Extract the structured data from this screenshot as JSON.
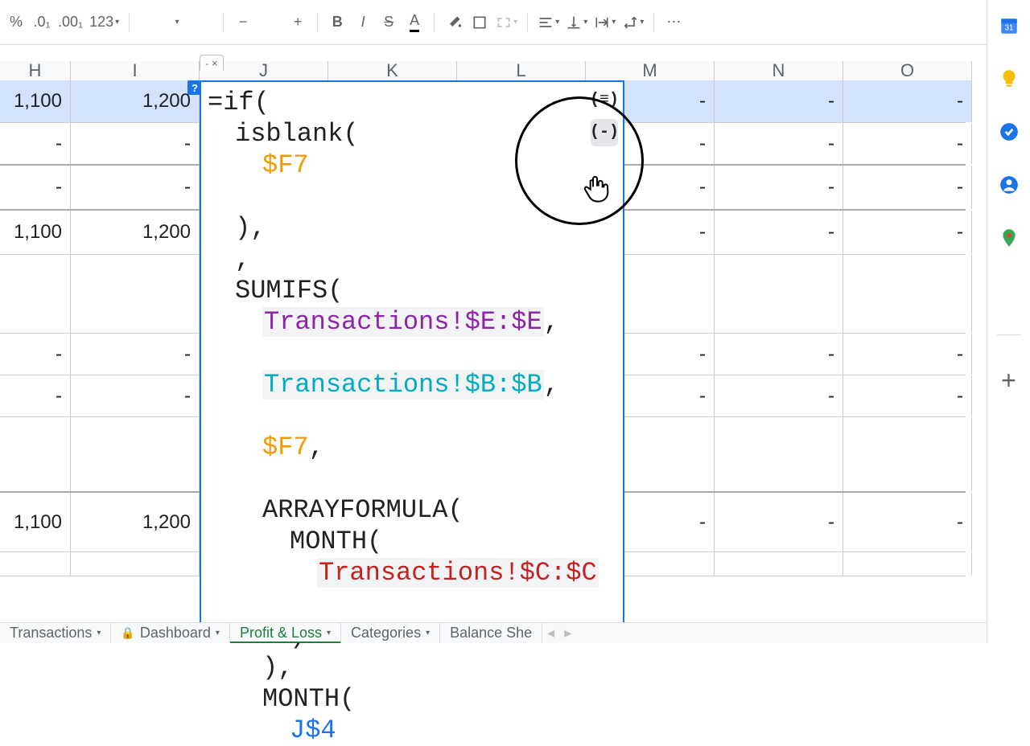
{
  "toolbar": {
    "percent_label": "%",
    "decdec_label": ".0₁",
    "incdec_label": ".00₁",
    "numfmt_label": "123",
    "bold_label": "B",
    "italic_label": "I"
  },
  "columns": [
    "H",
    "I",
    "J",
    "K",
    "L",
    "M",
    "N",
    "O"
  ],
  "rows": [
    {
      "sel": true,
      "css": "row-h53",
      "cells": [
        "1,100",
        "1,200",
        "",
        "",
        "",
        "-",
        "-",
        "-"
      ]
    },
    {
      "sel": false,
      "css": "row-h53b",
      "cells": [
        "-",
        "-",
        "",
        "",
        "",
        "-",
        "-",
        "-"
      ]
    },
    {
      "sel": false,
      "css": "row-h56",
      "cells": [
        "-",
        "-",
        "",
        "",
        "",
        "-",
        "-",
        "-"
      ]
    },
    {
      "sel": false,
      "css": "row-h55",
      "cells": [
        "1,100",
        "1,200",
        "",
        "",
        "",
        "-",
        "-",
        "-"
      ]
    },
    {
      "sel": false,
      "css": "row-h98",
      "cells": [
        "",
        "",
        "",
        "",
        "",
        "",
        "",
        ""
      ]
    },
    {
      "sel": false,
      "css": "row-h52",
      "cells": [
        "-",
        "-",
        "",
        "",
        "",
        "-",
        "-",
        "-"
      ]
    },
    {
      "sel": false,
      "css": "row-h52",
      "cells": [
        "-",
        "-",
        "",
        "",
        "",
        "-",
        "-",
        "-"
      ]
    },
    {
      "sel": false,
      "css": "row-h94",
      "cells": [
        "",
        "",
        "",
        "",
        "",
        "",
        "",
        ""
      ]
    },
    {
      "sel": false,
      "css": "row-h74",
      "cells": [
        "1,100",
        "1,200",
        "",
        "",
        "",
        "-",
        "-",
        "-"
      ]
    },
    {
      "sel": false,
      "css": "row-h30",
      "cells": [
        "",
        "",
        "",
        "",
        "",
        "",
        "",
        ""
      ]
    }
  ],
  "formula_tab": {
    "dash": "-",
    "close": "×"
  },
  "formula_help": "?",
  "formula": {
    "l1": "=if(",
    "l2_a": "isblank(",
    "l3_ref": "$F7",
    "l4": "),",
    "l5": ",",
    "l6": "SUMIFS(",
    "l7_rng": "Transactions!$E:$E",
    "l8_rng": "Transactions!$B:$B",
    "l9_ref": "$F7",
    "comma": ",",
    "l10": "ARRAYFORMULA(",
    "l11": "MONTH(",
    "l12_rng": "Transactions!$C:$C",
    "l13": ")",
    "l14": "),",
    "l15": "MONTH(",
    "l16_ref": "J$4"
  },
  "formula_buttons": {
    "layout": "(≡)",
    "collapse": "(-)"
  },
  "sheets": {
    "tab1": "Transactions",
    "tab2": "Dashboard",
    "tab3": "Profit & Loss",
    "tab4": "Categories",
    "tab5": "Balance She"
  },
  "nav": {
    "left": "◂",
    "right": "▸"
  }
}
